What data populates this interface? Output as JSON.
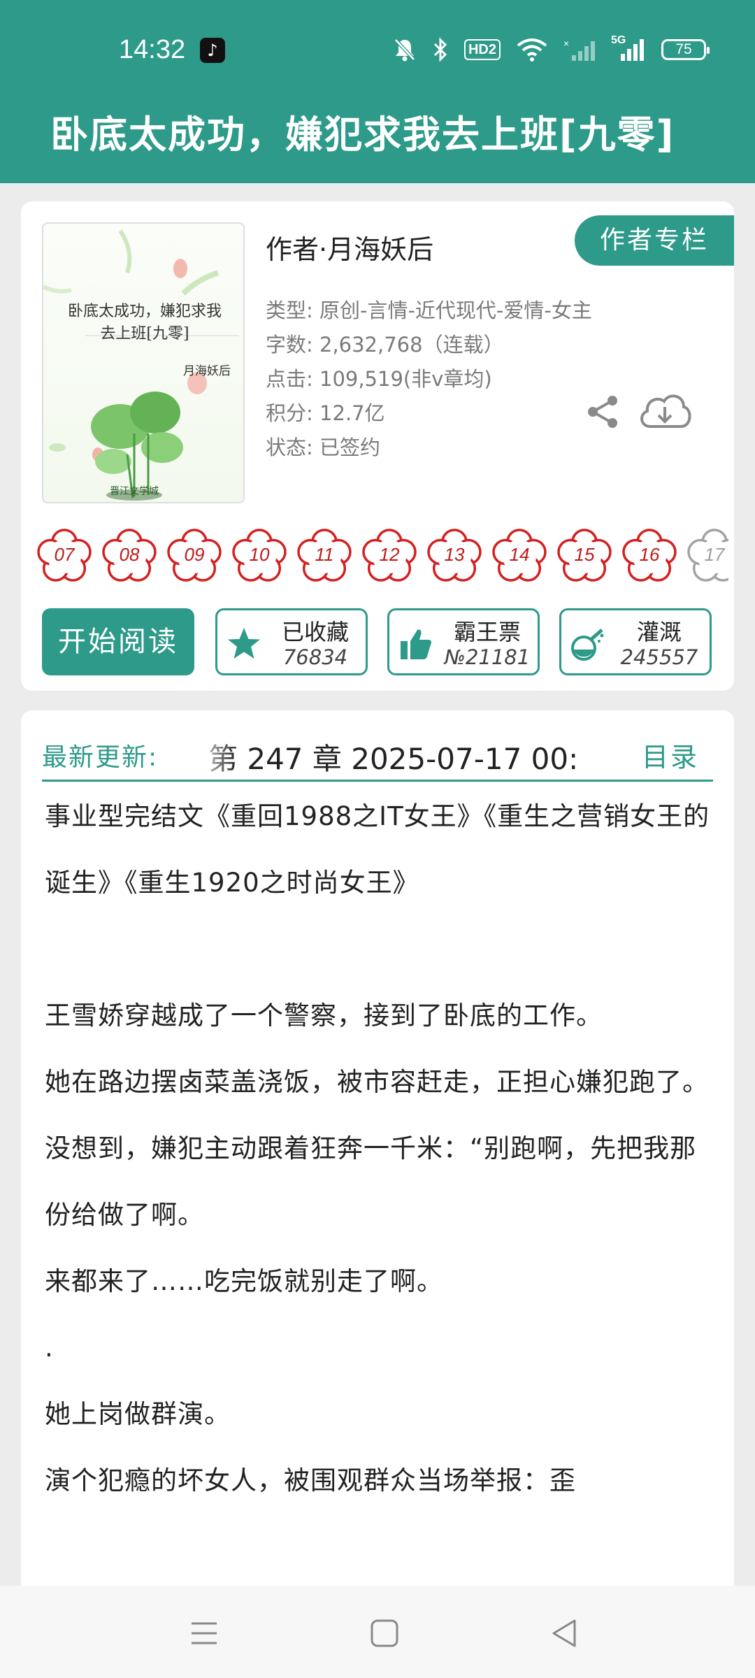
{
  "status_bar": {
    "time": "14:32",
    "hd_label": "HD2",
    "network_label": "5G",
    "battery": "75"
  },
  "header": {
    "title": "卧底太成功，嫌犯求我去上班[九零]"
  },
  "book": {
    "cover": {
      "title_line1": "卧底太成功，嫌犯求我",
      "title_line2": "去上班[九零]",
      "author": "月海妖后",
      "publisher": "晋江文学城"
    },
    "author_line": "作者·月海妖后",
    "author_column_button": "作者专栏",
    "meta": [
      "类型: 原创-言情-近代现代-爱情-女主",
      "字数: 2,632,768（连载）",
      "点击: 109,519(非v章均)",
      "积分: 12.7亿",
      "状态: 已签约"
    ],
    "share_icon": "share-icon",
    "download_icon": "cloud-download-icon"
  },
  "medals": [
    "07",
    "08",
    "09",
    "10",
    "11",
    "12",
    "13",
    "14",
    "15",
    "16",
    "17"
  ],
  "actions": {
    "read_label": "开始阅读",
    "favorite": {
      "label": "已收藏",
      "count": "76834"
    },
    "ticket": {
      "label": "霸王票",
      "count": "№21181"
    },
    "nutrient": {
      "label": "灌溉",
      "count": "245557"
    }
  },
  "latest": {
    "label": "最新更新:",
    "text": "第 247 章  2025-07-17 00:",
    "toc_label": "目录"
  },
  "description": [
    "事业型完结文《重回1988之IT女王》《重生之营销女王的诞生》《重生1920之时尚女王》",
    "",
    "王雪娇穿越成了一个警察，接到了卧底的工作。",
    "她在路边摆卤菜盖浇饭，被市容赶走，正担心嫌犯跑了。",
    "没想到，嫌犯主动跟着狂奔一千米：“别跑啊，先把我那份给做了啊。",
    "来都来了……吃完饭就别走了啊。",
    ".",
    "她上岗做群演。",
    "演个犯瘾的坏女人，被围观群众当场举报：歪"
  ],
  "colors": {
    "accent": "#2d9a8a",
    "medal_red": "#d42020"
  }
}
